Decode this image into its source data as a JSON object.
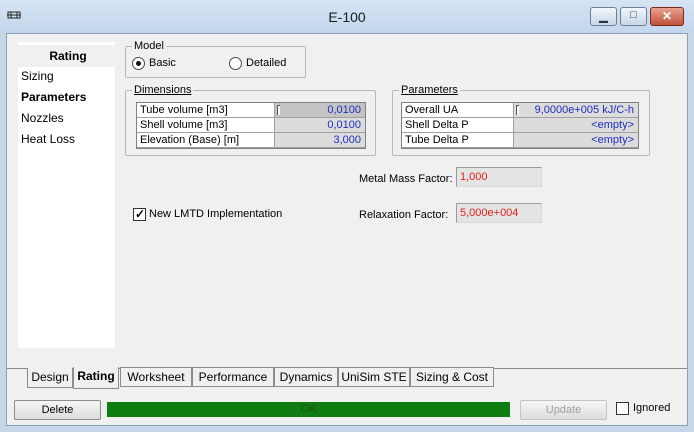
{
  "window": {
    "title": "E-100"
  },
  "nav": {
    "header": "Rating",
    "items": [
      {
        "label": "Sizing",
        "bold": false
      },
      {
        "label": "Parameters",
        "bold": true
      },
      {
        "label": "Nozzles",
        "bold": false
      },
      {
        "label": "Heat Loss",
        "bold": false
      }
    ]
  },
  "model": {
    "legend": "Model",
    "options": [
      {
        "label": "Basic",
        "selected": true
      },
      {
        "label": "Detailed",
        "selected": false
      }
    ]
  },
  "dimensions": {
    "legend": "Dimensions",
    "rows": [
      {
        "label": "Tube volume [m3]",
        "value": "0,0100"
      },
      {
        "label": "Shell volume [m3]",
        "value": "0,0100"
      },
      {
        "label": "Elevation (Base) [m]",
        "value": "3,000"
      }
    ]
  },
  "parameters": {
    "legend": "Parameters",
    "rows": [
      {
        "label": "Overall UA",
        "value": "9,0000e+005 kJ/C-h"
      },
      {
        "label": "Shell Delta P",
        "value": "<empty>"
      },
      {
        "label": "Tube Delta P",
        "value": "<empty>"
      }
    ]
  },
  "metal_mass": {
    "label": "Metal Mass Factor:",
    "value": "1,000"
  },
  "relaxation": {
    "label": "Relaxation Factor:",
    "value": "5,000e+004"
  },
  "lmtd": {
    "label": "New LMTD Implementation",
    "checked": true
  },
  "tabs": [
    "Design",
    "Rating",
    "Worksheet",
    "Performance",
    "Dynamics",
    "UniSim STE",
    "Sizing & Cost"
  ],
  "active_tab": "Rating",
  "footer": {
    "delete_label": "Delete",
    "status_text": "OK",
    "update_label": "Update",
    "ignored_label": "Ignored",
    "ignored_checked": false
  },
  "colors": {
    "status_ok": "#0f7e12",
    "value_blue": "#1e2fbf",
    "value_red": "#e0201a"
  }
}
